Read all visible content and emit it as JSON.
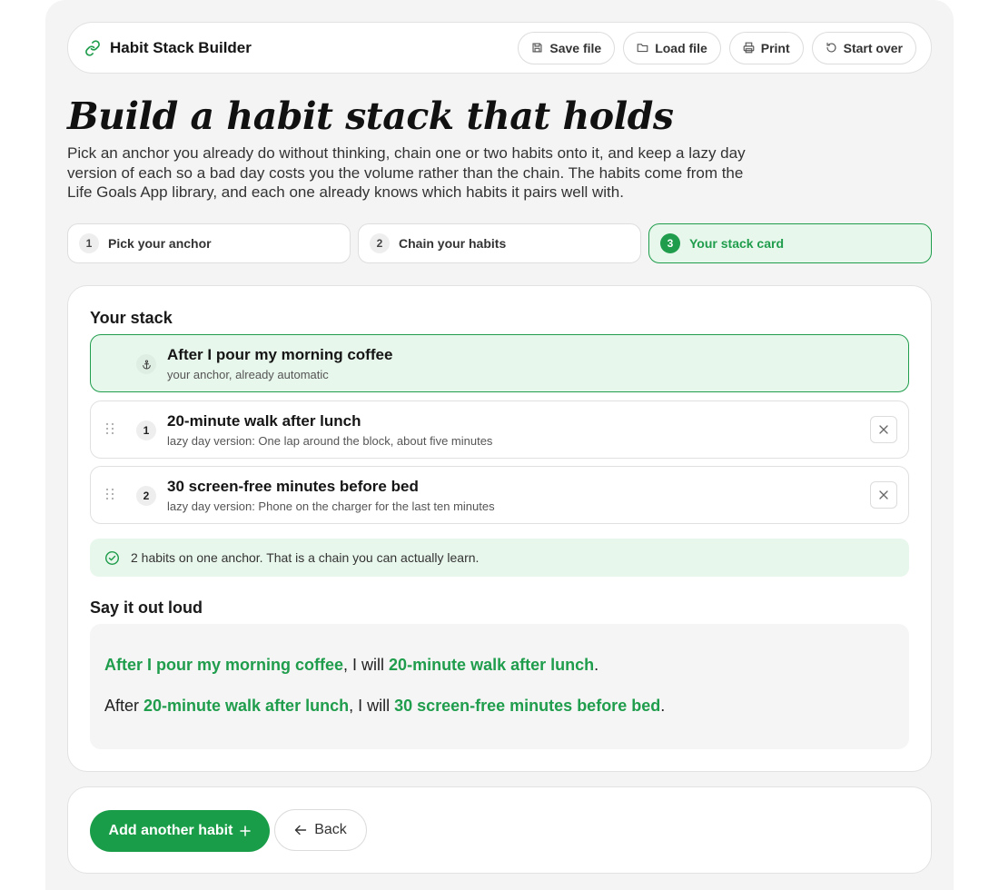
{
  "header": {
    "title": "Habit Stack Builder",
    "actions": [
      {
        "label": "Save file",
        "icon": "save-icon"
      },
      {
        "label": "Load file",
        "icon": "folder-icon"
      },
      {
        "label": "Print",
        "icon": "printer-icon"
      },
      {
        "label": "Start over",
        "icon": "reset-icon"
      }
    ]
  },
  "hero": {
    "title": "Build a habit stack that holds",
    "description": "Pick an anchor you already do without thinking, chain one or two habits onto it, and keep a lazy day version of each so a bad day costs you the volume rather than the chain. The habits come from the Life Goals App library, and each one already knows which habits it pairs well with."
  },
  "steps": [
    {
      "number": "1",
      "label": "Pick your anchor",
      "active": false
    },
    {
      "number": "2",
      "label": "Chain your habits",
      "active": false
    },
    {
      "number": "3",
      "label": "Your stack card",
      "active": true
    }
  ],
  "stack": {
    "title": "Your stack",
    "anchor": {
      "title": "After I pour my morning coffee",
      "subtitle": "your anchor, already automatic",
      "icon": "anchor-icon"
    },
    "habits": [
      {
        "number": "1",
        "title": "20-minute walk after lunch",
        "subtitle": "lazy day version: One lap around the block, about five minutes"
      },
      {
        "number": "2",
        "title": "30 screen-free minutes before bed",
        "subtitle": "lazy day version: Phone on the charger for the last ten minutes"
      }
    ],
    "notice": "2 habits on one anchor. That is a chain you can actually learn."
  },
  "say_it": {
    "title": "Say it out loud",
    "lines": [
      {
        "prefix": "",
        "first": "After I pour my morning coffee",
        "middle": ", I will ",
        "second": "20-minute walk after lunch",
        "suffix": "."
      },
      {
        "prefix": "After ",
        "first": "20-minute walk after lunch",
        "middle": ", I will ",
        "second": "30 screen-free minutes before bed",
        "suffix": "."
      }
    ]
  },
  "footer": {
    "add_label": "Add another habit",
    "back_label": "Back"
  },
  "colors": {
    "accent": "#1f9d4c",
    "accent_light": "#e8f7ec"
  }
}
